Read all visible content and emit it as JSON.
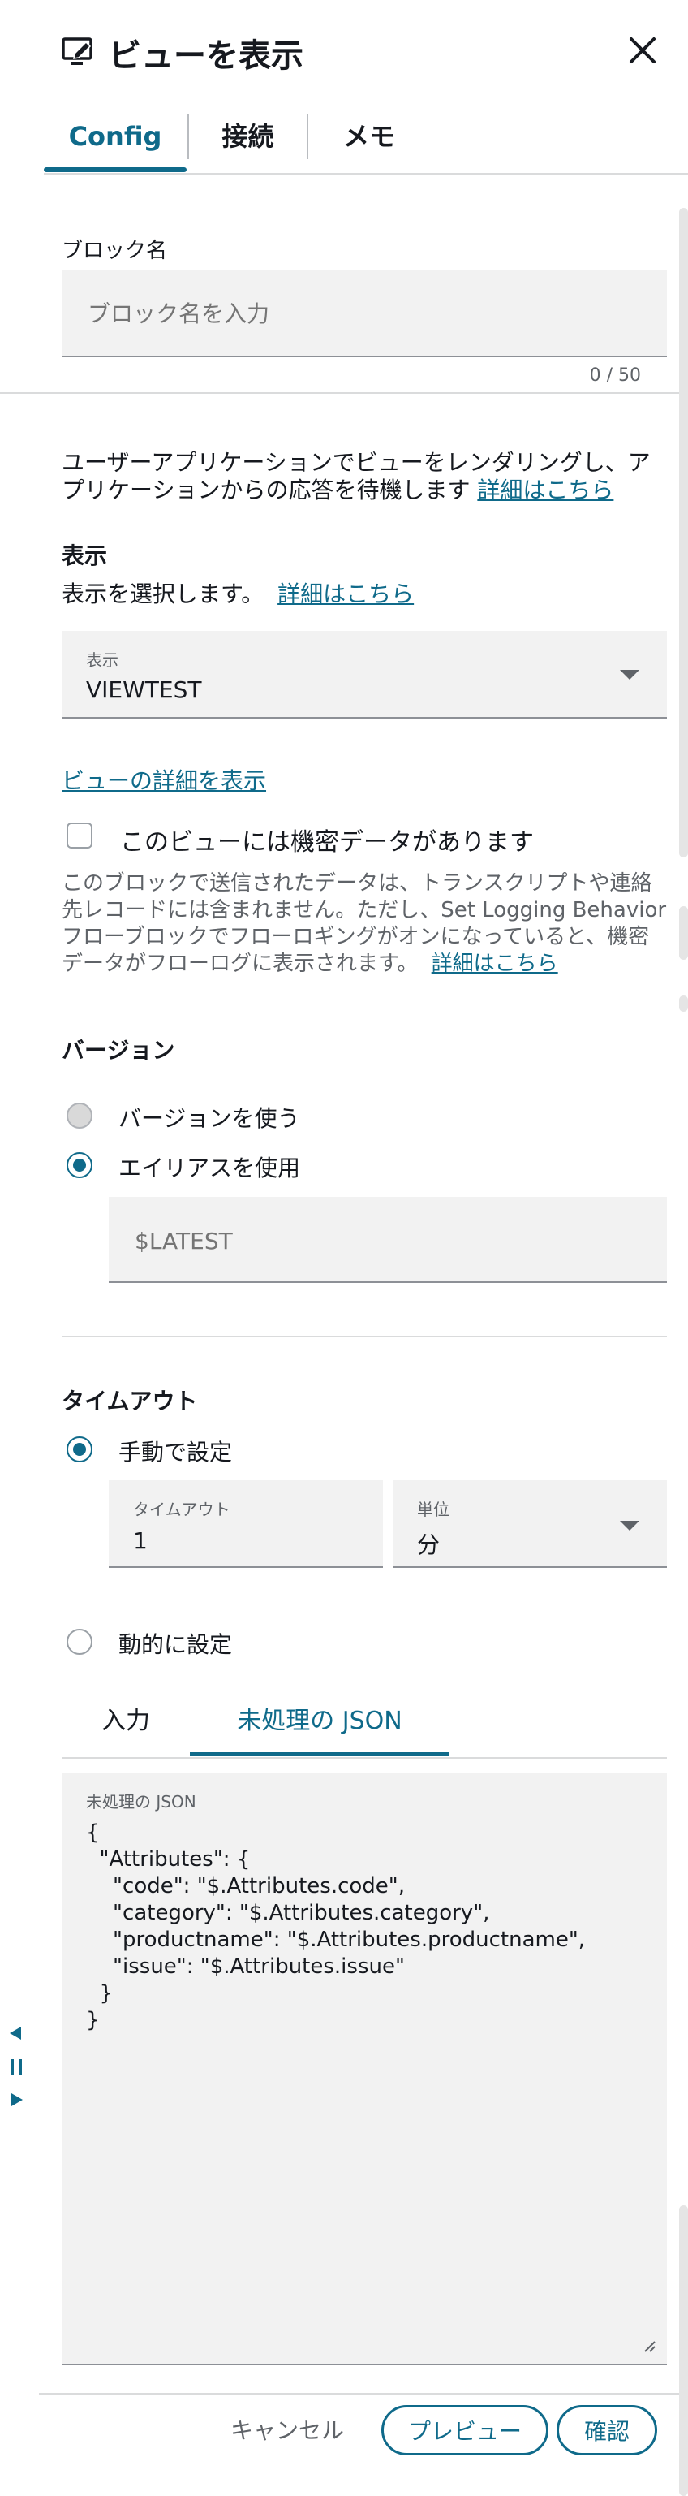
{
  "header": {
    "title": "ビューを表示",
    "icon": "monitor-edit-icon",
    "close_icon": "close-icon"
  },
  "tabs": [
    {
      "label": "Config",
      "active": true
    },
    {
      "label": "接続",
      "active": false
    },
    {
      "label": "メモ",
      "active": false
    }
  ],
  "block_name": {
    "label": "ブロック名",
    "placeholder": "ブロック名を入力",
    "value": "",
    "counter": "0 / 50"
  },
  "description": {
    "line1": "ユーザーアプリケーションでビューをレンダリングし、ア",
    "line2": "プリケーションからの応答を待機します",
    "link": "詳細はこちら"
  },
  "display": {
    "heading": "表示",
    "subtext": "表示を選択します。",
    "link": "詳細はこちら",
    "select_label": "表示",
    "select_value": "VIEWTEST",
    "view_details_link": "ビューの詳細を表示"
  },
  "sensitive": {
    "checkbox_label": "このビューには機密データがあります",
    "checked": false,
    "note_line1": "このブロックで送信されたデータは、トランスクリプトや連絡",
    "note_line2": "先レコードには含まれません。ただし、Set Logging Behavior",
    "note_line3": "フローブロックでフローロギングがオンになっていると、機密",
    "note_line4": "データがフローログに表示されます。",
    "note_link": "詳細はこちら"
  },
  "version": {
    "heading": "バージョン",
    "option_version": "バージョンを使う",
    "option_alias": "エイリアスを使用",
    "selected": "alias",
    "alias_placeholder": "$LATEST"
  },
  "timeout": {
    "heading": "タイムアウト",
    "option_manual": "手動で設定",
    "option_dynamic": "動的に設定",
    "selected": "manual",
    "timeout_label": "タイムアウト",
    "timeout_value": "1",
    "unit_label": "単位",
    "unit_value": "分"
  },
  "json_tabs": [
    {
      "label": "入力",
      "active": false
    },
    {
      "label": "未処理の JSON",
      "active": true
    }
  ],
  "raw_json": {
    "label": "未処理の JSON",
    "content": "{\n  \"Attributes\": {\n    \"code\": \"$.Attributes.code\",\n    \"category\": \"$.Attributes.category\",\n    \"productname\": \"$.Attributes.productname\",\n    \"issue\": \"$.Attributes.issue\"\n  }\n}"
  },
  "footer": {
    "cancel": "キャンセル",
    "preview": "プレビュー",
    "confirm": "確認"
  },
  "colors": {
    "accent": "#0f6a8a",
    "field_bg": "#f2f2f2",
    "text": "#16191f"
  }
}
